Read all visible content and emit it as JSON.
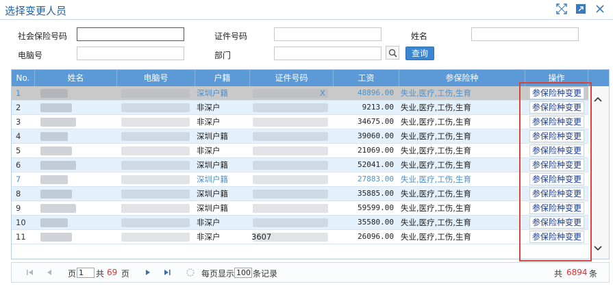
{
  "window": {
    "title": "选择变更人员",
    "icons": [
      "fullscreen-icon",
      "external-open-icon",
      "close-icon"
    ]
  },
  "form": {
    "social_no_label": "社会保险号码",
    "id_no_label": "证件号码",
    "name_label": "姓名",
    "pc_no_label": "电脑号",
    "dept_label": "部门",
    "query_label": "查询"
  },
  "grid": {
    "headers": [
      "No.",
      "姓名",
      "电脑号",
      "户籍",
      "证件号码",
      "工资",
      "参保险种",
      "操作"
    ],
    "rows": [
      {
        "no": "1",
        "huji": "深圳户籍",
        "wage": "48896.00",
        "ins": "失业,医疗,工伤,生育",
        "op": "参保险种变更",
        "id_tail": "X"
      },
      {
        "no": "2",
        "huji": "非深户",
        "wage": "9213.00",
        "ins": "失业,医疗,工伤,生育",
        "op": "参保险种变更"
      },
      {
        "no": "3",
        "huji": "非深户",
        "wage": "34675.00",
        "ins": "失业,医疗,工伤,生育",
        "op": "参保险种变更"
      },
      {
        "no": "4",
        "huji": "深圳户籍",
        "wage": "39060.00",
        "ins": "失业,医疗,工伤,生育",
        "op": "参保险种变更"
      },
      {
        "no": "5",
        "huji": "非深户",
        "wage": "21069.00",
        "ins": "失业,医疗,工伤,生育",
        "op": "参保险种变更"
      },
      {
        "no": "6",
        "huji": "深圳户籍",
        "wage": "52041.00",
        "ins": "失业,医疗,工伤,生育",
        "op": "参保险种变更"
      },
      {
        "no": "7",
        "huji": "深圳户籍",
        "wage": "27883.00",
        "ins": "失业,医疗,工伤,生育",
        "op": "参保险种变更"
      },
      {
        "no": "8",
        "huji": "深圳户籍",
        "wage": "35885.00",
        "ins": "失业,医疗,工伤,生育",
        "op": "参保险种变更"
      },
      {
        "no": "9",
        "huji": "深圳户籍",
        "wage": "59599.00",
        "ins": "失业,医疗,工伤,生育",
        "op": "参保险种变更"
      },
      {
        "no": "10",
        "huji": "非深户",
        "wage": "35580.00",
        "ins": "失业,医疗,工伤,生育",
        "op": "参保险种变更"
      },
      {
        "no": "11",
        "huji": "非深户",
        "wage": "26096.00",
        "ins": "失业,医疗,工伤,生育",
        "op": "参保险种变更",
        "id_head": "3607"
      }
    ]
  },
  "pager": {
    "page_label": "页",
    "page_value": "1",
    "total_prefix": "共",
    "total_pages": "69",
    "pages_suffix": "页",
    "per_page_label": "每页显示",
    "per_page_value": "100",
    "records_suffix": "条记录",
    "count_prefix": "共",
    "total_records": "6894",
    "count_suffix": "条"
  },
  "colors": {
    "header": "#5b9ad6",
    "alt_row": "#e4f0fa",
    "selected_row": "#c9c9c9",
    "highlight_box": "#d9433c",
    "accent_red": "#e0312e"
  }
}
